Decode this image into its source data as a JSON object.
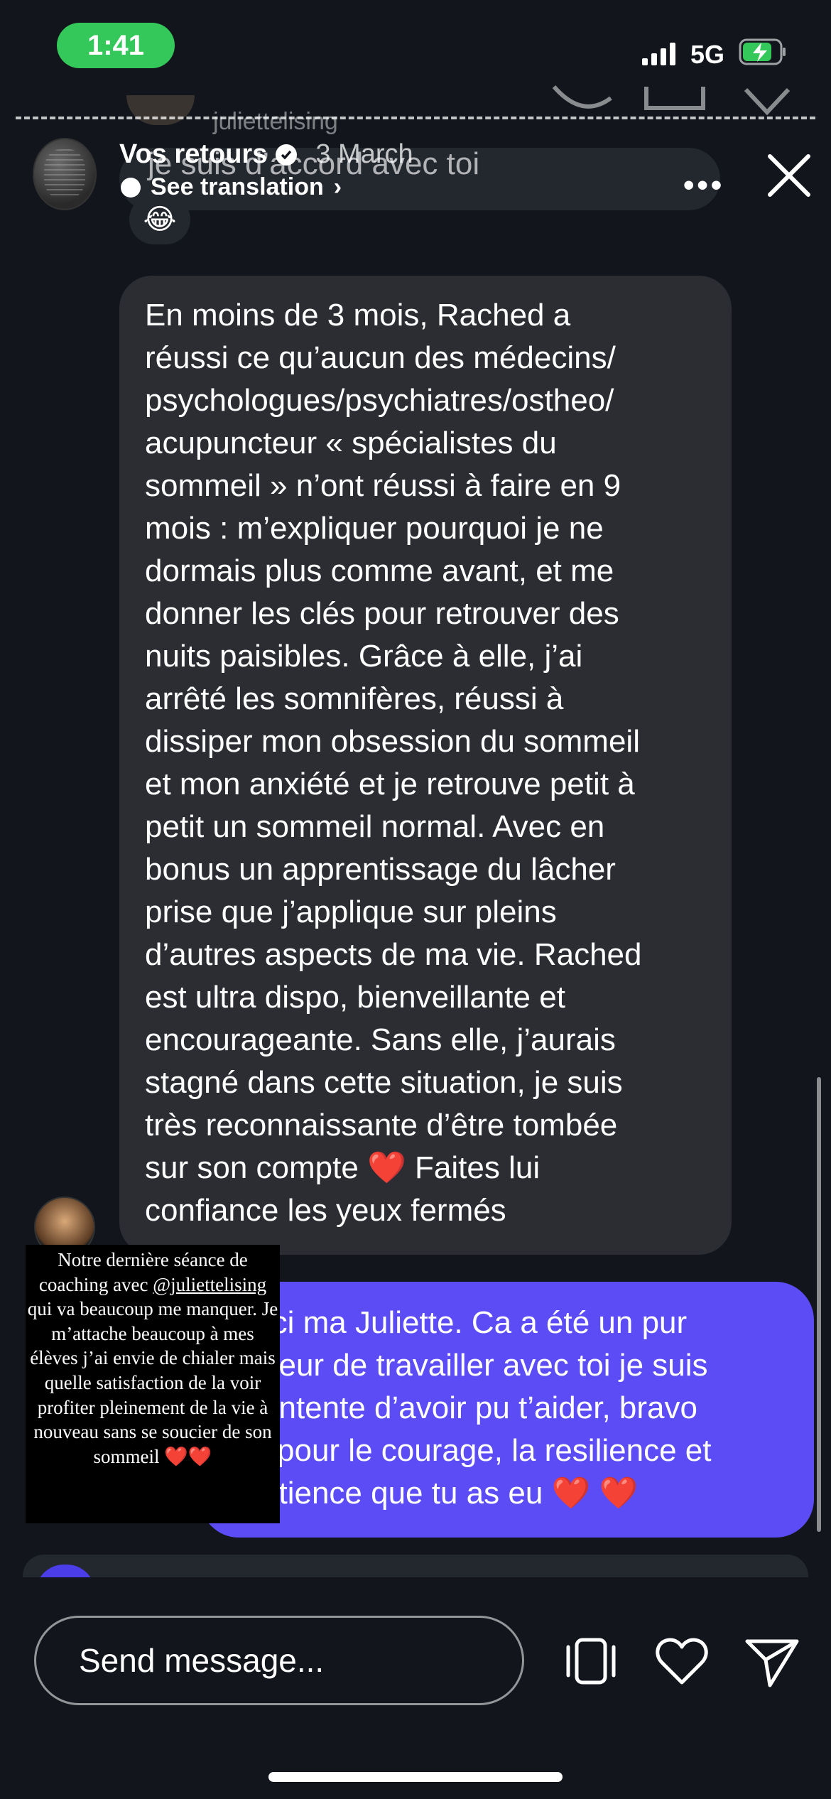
{
  "status_bar": {
    "time": "1:41",
    "network": "5G"
  },
  "header": {
    "account": "Vos retours",
    "date": "3 March",
    "background_username": "juliettelising",
    "quoted_reply": "je suis d’accord avec toi",
    "see_translation": "See translation",
    "reaction_emoji": "😂"
  },
  "messages": {
    "received": "En moins de 3 mois, Rached a\nréussi ce qu’aucun des médecins/\npsychologues/psychiatres/ostheo/\nacupuncteur « spécialistes du\nsommeil » n’ont réussi à faire en 9\nmois : m’expliquer pourquoi je ne\ndormais plus comme avant, et me\ndonner les clés pour retrouver des\nnuits paisibles. Grâce à elle, j’ai\narrêté les somnifères, réussi à\ndissiper mon obsession du sommeil\net mon anxiété et je retrouve petit à\npetit un sommeil normal. Avec en\nbonus un apprentissage du lâcher\nprise que j’applique sur pleins\nd’autres aspects de ma vie. Rached\nest ultra dispo, bienveillante et\nencourageante. Sans elle, j’aurais\nstagné dans cette situation, je suis\ntrès reconnaissante d’être tombée\nsur son compte ❤️ Faites lui\nconfiance les yeux fermés",
    "sent": "rci ma Juliette. Ca a été un pur\nheur de travailler avec toi je suis\nontente d’avoir pu t’aider, bravo\ni pour le courage, la resilience et\natience que tu as eu ❤️ ❤️"
  },
  "caption": {
    "line1": "Notre dernière séance de coaching avec",
    "mention": "@juliettelising",
    "line2": "qui va beaucoup me manquer. Je m’attache beaucoup à mes élèves j’ai envie de chialer mais quelle satisfaction de la voir profiter pleinement de la vie à nouveau sans se soucier de son sommeil ❤️❤️"
  },
  "composer": {
    "placeholder": "Send message..."
  },
  "icons": {
    "verified": "verified-badge-icon",
    "more": "more-dots-icon",
    "close": "close-icon",
    "share_carousel": "carousel-icon",
    "like": "heart-icon",
    "send": "send-icon"
  },
  "colors": {
    "sent_bubble": "#5b4cf5",
    "received_bubble": "#2b2d33",
    "status_time": "#34c759"
  }
}
